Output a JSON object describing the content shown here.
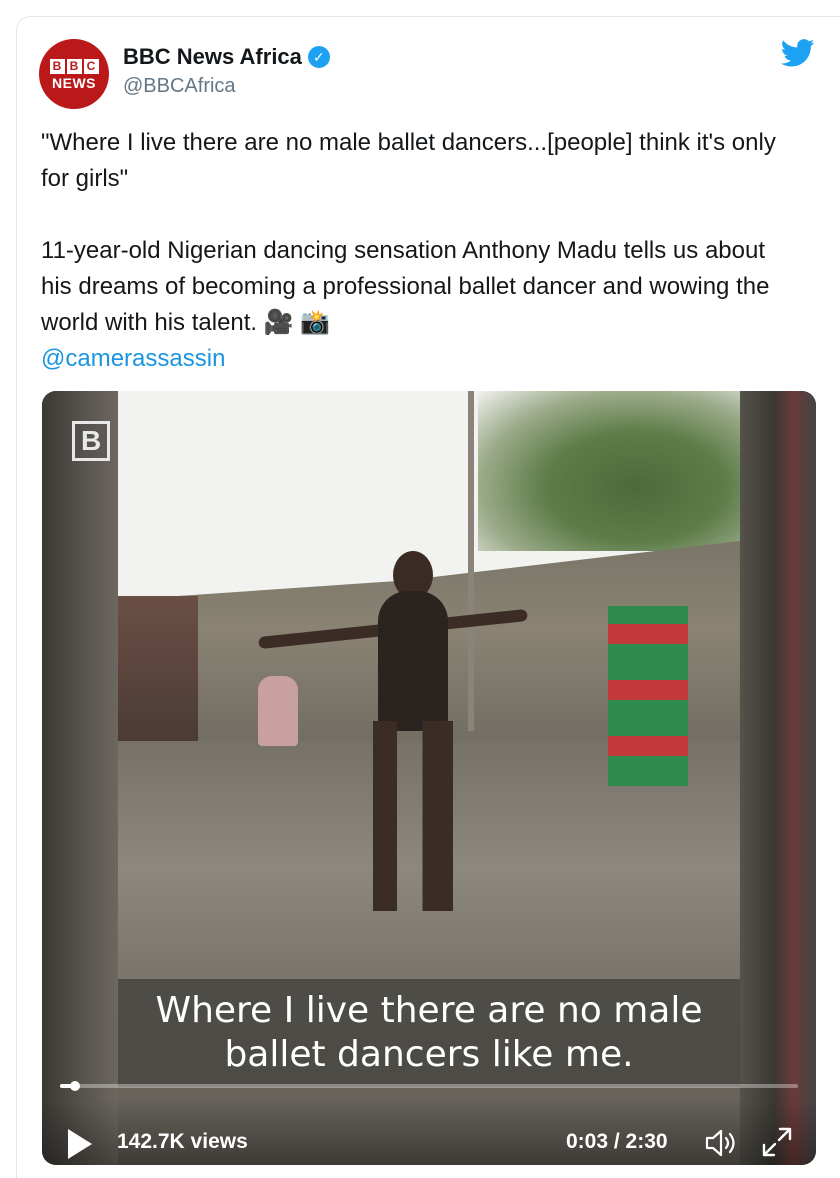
{
  "tweet": {
    "author_name": "BBC News Africa",
    "handle": "@BBCAfrica",
    "avatar": {
      "blocks": [
        "B",
        "B",
        "C"
      ],
      "text": "NEWS",
      "color": "#bb1919"
    },
    "verified_icon": "verified-badge-icon",
    "brand_icon": "twitter-bird-icon",
    "text_quote": "\"Where I live there are no male ballet dancers...[people] think it's only for girls\"",
    "text_body": "11-year-old Nigerian dancing sensation Anthony Madu tells us about his dreams of becoming a professional ballet dancer and wowing the world with his talent. 🎥 📸",
    "mention": "@camerassassin"
  },
  "video": {
    "watermark": "B",
    "caption_line1": "Where I live there are no male",
    "caption_line2": "ballet dancers like me.",
    "views": "142.7K views",
    "time": "0:03 / 2:30",
    "progress": 0.02,
    "icons": {
      "play": "play-icon",
      "volume": "volume-icon",
      "fullscreen": "fullscreen-icon"
    }
  },
  "colors": {
    "link": "#1b95e0",
    "twitter_blue": "#1da1f2",
    "bbc_red": "#bb1919",
    "secondary_text": "#657786"
  }
}
